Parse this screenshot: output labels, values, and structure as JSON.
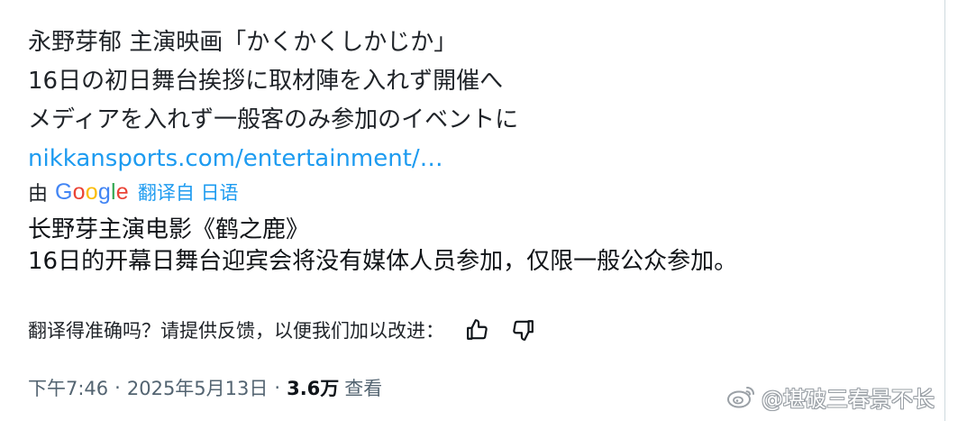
{
  "tweet": {
    "text_lines": [
      "永野芽郁 主演映画「かくかくしかじか」",
      "16日の初日舞台挨拶に取材陣を入れず開催へ",
      "メディアを入れず一般客のみ参加のイベントに"
    ],
    "link_text": "nikkansports.com/entertainment/…"
  },
  "translation": {
    "by_label": "由",
    "provider_letters": [
      "G",
      "o",
      "o",
      "g",
      "l",
      "e"
    ],
    "translated_from_label": "翻译自 日语",
    "translated_lines": [
      "长野芽主演电影《鹤之鹿》",
      "16日的开幕日舞台迎宾会将没有媒体人员参加，仅限一般公众参加。"
    ],
    "feedback_prompt": "翻译得准确吗？请提供反馈，以便我们加以改进："
  },
  "meta": {
    "time": "下午7:46",
    "separator_1": "·",
    "date": "2025年5月13日",
    "separator_2": "·",
    "views_count": "3.6万",
    "views_label": "查看"
  },
  "watermark": {
    "text": "@堪破三春景不长"
  },
  "icons": {
    "thumbs_up": "thumbs-up-icon",
    "thumbs_down": "thumbs-down-icon",
    "weibo": "weibo-logo-icon"
  },
  "colors": {
    "link": "#1d9bf0",
    "text": "#0f1419",
    "secondary": "#536471",
    "google_blue": "#4285f4",
    "google_red": "#ea4335",
    "google_yellow": "#fbbc05",
    "google_green": "#34a853"
  }
}
